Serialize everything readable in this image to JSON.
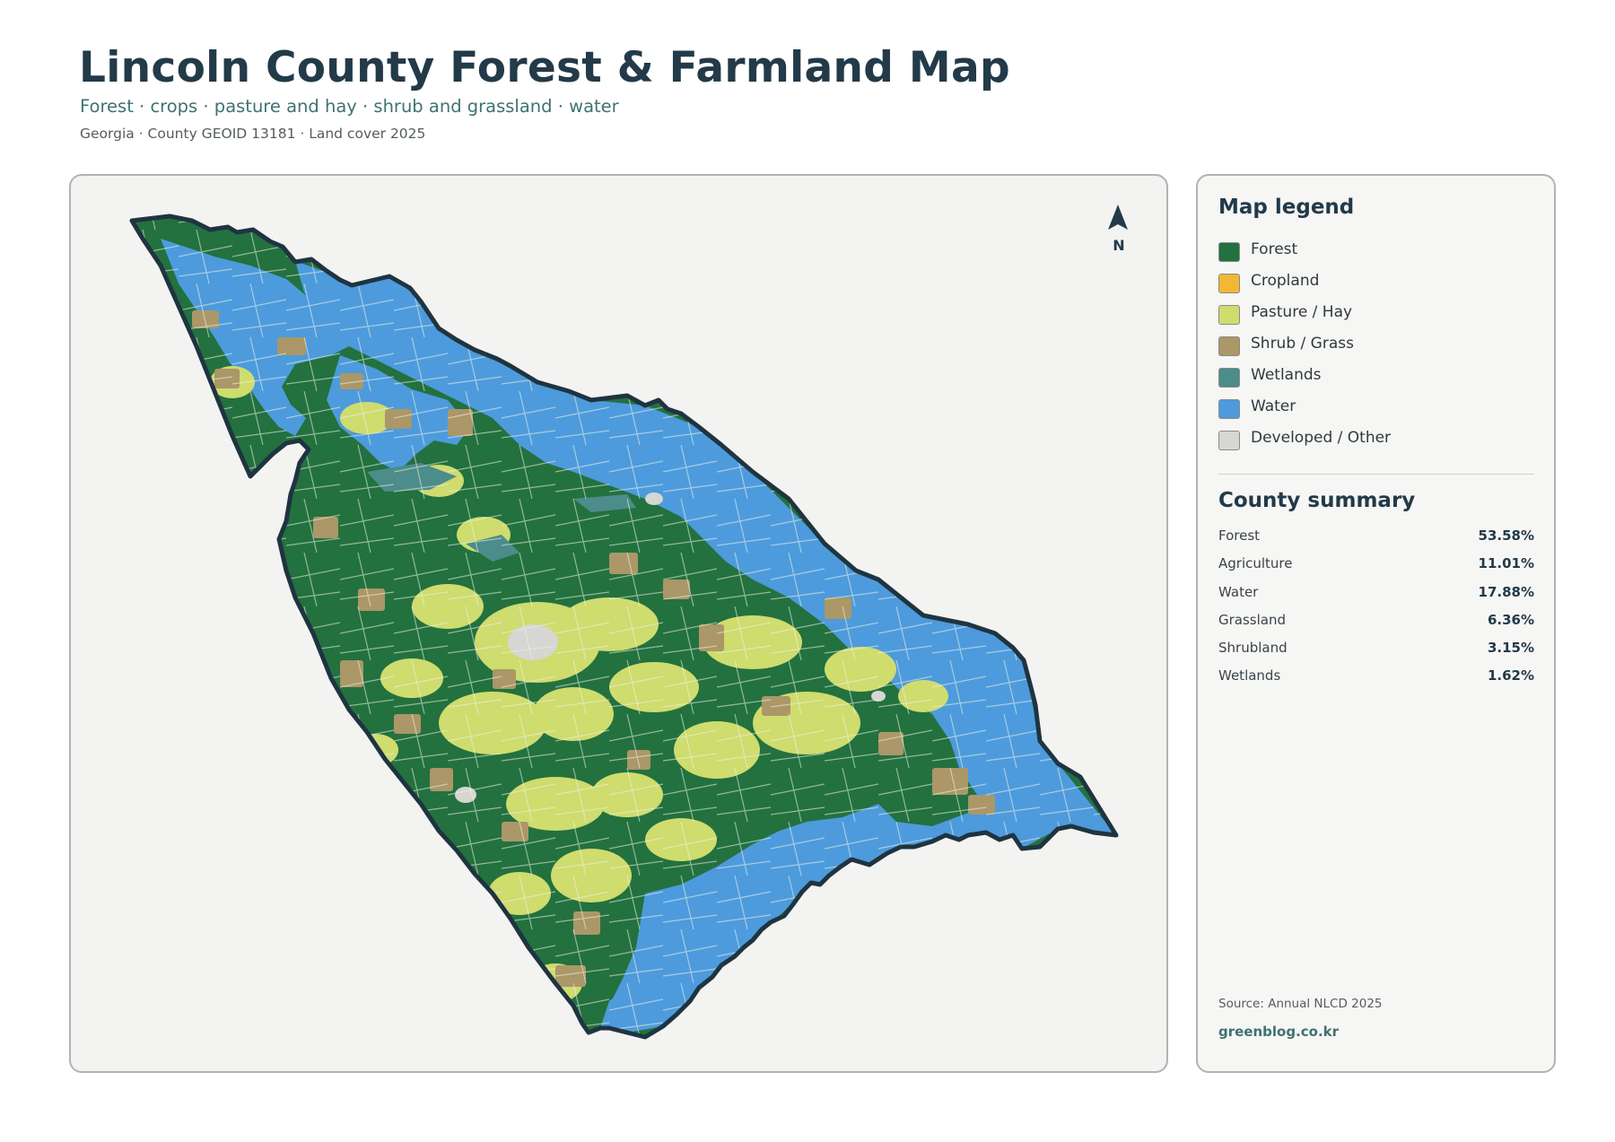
{
  "header": {
    "title": "Lincoln County Forest & Farmland Map",
    "subtitle": "Forest · crops · pasture and hay · shrub and grassland · water",
    "meta": "Georgia · County GEOID 13181 · Land cover 2025"
  },
  "map": {
    "north_label": "N"
  },
  "legend": {
    "title": "Map legend",
    "items": [
      {
        "label": "Forest",
        "color": "#23713f"
      },
      {
        "label": "Cropland",
        "color": "#f2b733"
      },
      {
        "label": "Pasture / Hay",
        "color": "#cfdc6e"
      },
      {
        "label": "Shrub / Grass",
        "color": "#ab9767"
      },
      {
        "label": "Wetlands",
        "color": "#4c8c8a"
      },
      {
        "label": "Water",
        "color": "#4d9bdc"
      },
      {
        "label": "Developed / Other",
        "color": "#d6d6d3"
      }
    ]
  },
  "summary": {
    "title": "County summary",
    "rows": [
      {
        "label": "Forest",
        "value": "53.58%"
      },
      {
        "label": "Agriculture",
        "value": "11.01%"
      },
      {
        "label": "Water",
        "value": "17.88%"
      },
      {
        "label": "Grassland",
        "value": "6.36%"
      },
      {
        "label": "Shrubland",
        "value": "3.15%"
      },
      {
        "label": "Wetlands",
        "value": "1.62%"
      }
    ],
    "source": "Source: Annual NLCD 2025",
    "site": "greenblog.co.kr"
  }
}
